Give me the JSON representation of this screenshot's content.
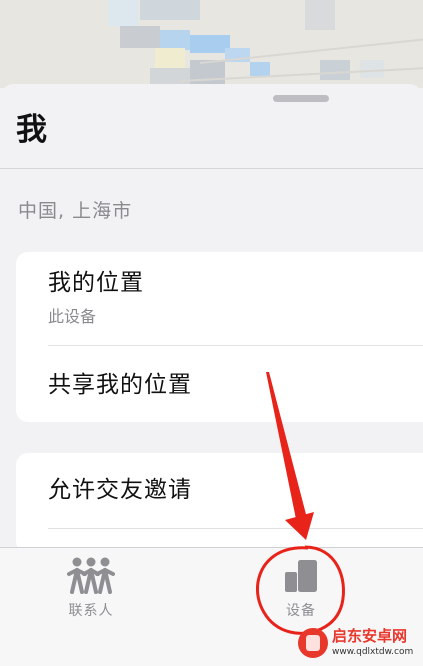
{
  "sheet": {
    "title": "我",
    "location": "中国, 上海市"
  },
  "location_card": {
    "my_location": {
      "title": "我的位置",
      "subtitle": "此设备"
    },
    "share_location": {
      "title": "共享我的位置"
    }
  },
  "friends_card": {
    "allow_invites": {
      "title": "允许交友邀请"
    }
  },
  "tabbar": {
    "tabs": [
      {
        "label": "联系人",
        "icon": "people-icon",
        "selected": false
      },
      {
        "label": "设备",
        "icon": "devices-icon",
        "selected": false
      }
    ]
  },
  "annotation": {
    "color": "#e8231a",
    "highlights": "设备"
  },
  "watermark": {
    "title": "启东安卓网",
    "url": "www.qdlxtdw.com"
  },
  "colors": {
    "background": "#f2f2f4",
    "card": "#ffffff",
    "secondary_text": "#8a8a8f",
    "tab_inactive": "#8e8e93"
  }
}
